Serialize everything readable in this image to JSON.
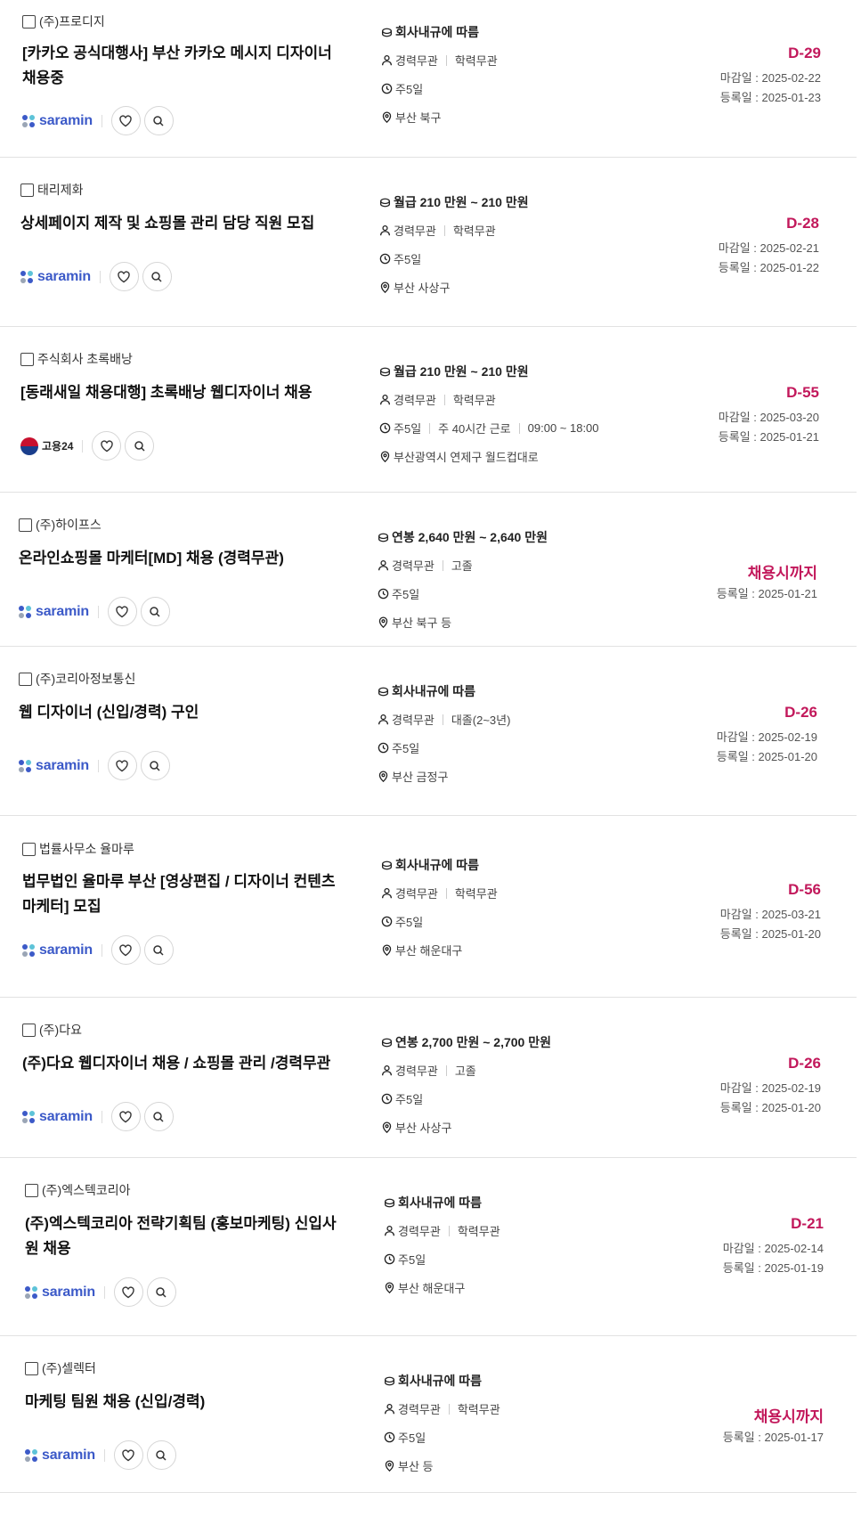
{
  "colors": {
    "accent": "#c2185b",
    "saramin": "#3c5ac8"
  },
  "jobs": [
    {
      "company": "(주)프로디지",
      "title": [
        "[카카오 공식대행사] 부산 카카오 메시지 디자이너",
        "채용중"
      ],
      "source": "saramin",
      "source_label": "saramin",
      "pay": "회사내규에 따름",
      "career": "경력무관",
      "education": "학력무관",
      "schedule": [
        "주5일"
      ],
      "location": "부산 북구",
      "dday": "D-29",
      "deadline": "마감일 : 2025-02-22",
      "registered": "등록일 : 2025-01-23"
    },
    {
      "company": "태리제화",
      "title": [
        "상세페이지 제작 및 쇼핑몰 관리 담당 직원 모집"
      ],
      "source": "saramin",
      "source_label": "saramin",
      "pay": "월급 210 만원 ~ 210 만원",
      "career": "경력무관",
      "education": "학력무관",
      "schedule": [
        "주5일"
      ],
      "location": "부산 사상구",
      "dday": "D-28",
      "deadline": "마감일 : 2025-02-21",
      "registered": "등록일 : 2025-01-22"
    },
    {
      "company": "주식회사 초록배낭",
      "title": [
        "[동래새일 채용대행] 초록배낭 웹디자이너 채용"
      ],
      "source": "goyong",
      "source_label": "고용24",
      "pay": "월급 210 만원 ~ 210 만원",
      "career": "경력무관",
      "education": "학력무관",
      "schedule": [
        "주5일",
        "주 40시간 근로",
        "09:00 ~ 18:00"
      ],
      "location": "부산광역시 연제구 월드컵대로",
      "dday": "D-55",
      "deadline": "마감일 : 2025-03-20",
      "registered": "등록일 : 2025-01-21"
    },
    {
      "company": "(주)하이프스",
      "title": [
        "온라인쇼핑몰 마케터[MD] 채용 (경력무관)"
      ],
      "source": "saramin",
      "source_label": "saramin",
      "pay": "연봉 2,640 만원 ~ 2,640 만원",
      "career": "경력무관",
      "education": "고졸",
      "schedule": [
        "주5일"
      ],
      "location": "부산 북구 등",
      "dday": "채용시까지",
      "deadline": "",
      "registered": "등록일 : 2025-01-21"
    },
    {
      "company": "(주)코리아정보통신",
      "title": [
        "웹 디자이너 (신입/경력) 구인"
      ],
      "source": "saramin",
      "source_label": "saramin",
      "pay": "회사내규에 따름",
      "career": "경력무관",
      "education": "대졸(2~3년)",
      "schedule": [
        "주5일"
      ],
      "location": "부산 금정구",
      "dday": "D-26",
      "deadline": "마감일 : 2025-02-19",
      "registered": "등록일 : 2025-01-20"
    },
    {
      "company": "법률사무소 율마루",
      "title": [
        "법무법인 율마루 부산 [영상편집 / 디자이너 컨텐츠",
        "마케터] 모집"
      ],
      "source": "saramin",
      "source_label": "saramin",
      "pay": "회사내규에 따름",
      "career": "경력무관",
      "education": "학력무관",
      "schedule": [
        "주5일"
      ],
      "location": "부산 해운대구",
      "dday": "D-56",
      "deadline": "마감일 : 2025-03-21",
      "registered": "등록일 : 2025-01-20"
    },
    {
      "company": "(주)다요",
      "title": [
        "(주)다요 웹디자이너 채용 / 쇼핑몰 관리 /경력무관"
      ],
      "source": "saramin",
      "source_label": "saramin",
      "pay": "연봉 2,700 만원 ~ 2,700 만원",
      "career": "경력무관",
      "education": "고졸",
      "schedule": [
        "주5일"
      ],
      "location": "부산 사상구",
      "dday": "D-26",
      "deadline": "마감일 : 2025-02-19",
      "registered": "등록일 : 2025-01-20"
    },
    {
      "company": "(주)엑스텍코리아",
      "title": [
        "(주)엑스텍코리아 전략기획팀 (홍보마케팅) 신입사",
        "원 채용"
      ],
      "source": "saramin",
      "source_label": "saramin",
      "pay": "회사내규에 따름",
      "career": "경력무관",
      "education": "학력무관",
      "schedule": [
        "주5일"
      ],
      "location": "부산 해운대구",
      "dday": "D-21",
      "deadline": "마감일 : 2025-02-14",
      "registered": "등록일 : 2025-01-19"
    },
    {
      "company": "(주)셀렉터",
      "title": [
        "마케팅 팀원 채용 (신입/경력)"
      ],
      "source": "saramin",
      "source_label": "saramin",
      "pay": "회사내규에 따름",
      "career": "경력무관",
      "education": "학력무관",
      "schedule": [
        "주5일"
      ],
      "location": "부산 등",
      "dday": "채용시까지",
      "deadline": "",
      "registered": "등록일 : 2025-01-17"
    }
  ]
}
